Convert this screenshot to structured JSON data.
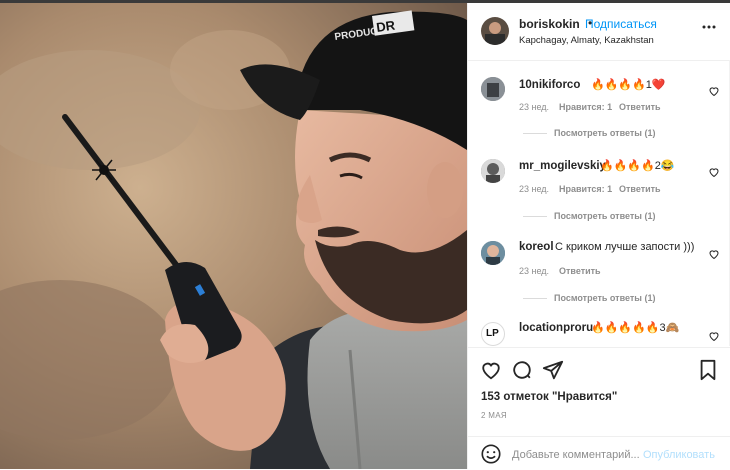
{
  "post": {
    "username": "boriskokin",
    "separator": "•",
    "follow_label": "Подписаться",
    "location": "Kapchagay, Almaty, Kazakhstan",
    "menu_icon": "more-horizontal-icon"
  },
  "comments": [
    {
      "username": "10nikiforco",
      "text": "🔥🔥🔥🔥1❤️",
      "age": "23 нед.",
      "likes": "Нравится: 1",
      "reply_label": "Ответить",
      "view_replies": "Посмотреть ответы (1)"
    },
    {
      "username": "mr_mogilevskiy",
      "text": "🔥🔥🔥🔥2😂",
      "age": "23 нед.",
      "likes": "Нравится: 1",
      "reply_label": "Ответить",
      "view_replies": "Посмотреть ответы (1)"
    },
    {
      "username": "koreol",
      "text": "С криком лучше запости )))",
      "age": "23 нед.",
      "reply_label": "Ответить",
      "view_replies": "Посмотреть ответы (1)"
    },
    {
      "username": "locationproru",
      "text": "🔥🔥🔥🔥🔥3🙈",
      "avatar_text": "LP"
    }
  ],
  "actions": {
    "likes_text": "153 отметок \"Нравится\"",
    "date": "2 МАЯ",
    "comment_placeholder": "Добавьте комментарий...",
    "publish_label": "Опубликовать"
  },
  "photo": {
    "cap_text": "PRODUCTION",
    "cap_logo": "DR"
  },
  "colors": {
    "accent": "#0095f6",
    "text": "#262626",
    "muted": "#8e8e8e",
    "border": "#efefef"
  }
}
